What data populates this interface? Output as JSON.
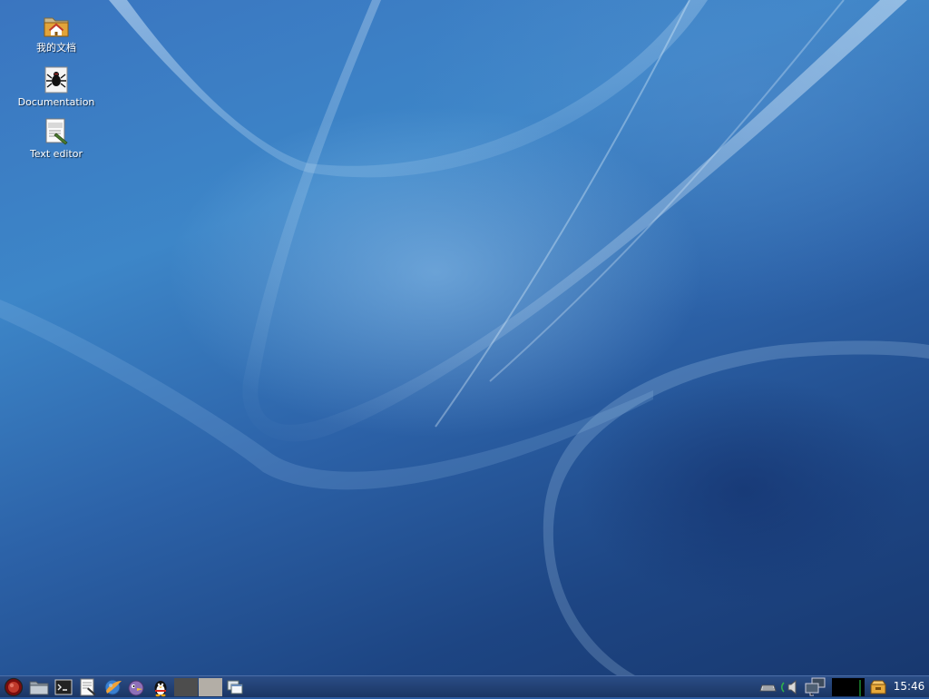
{
  "desktop": {
    "icons": [
      {
        "label": "我的文档",
        "icon": "home-folder-icon"
      },
      {
        "label": "Documentation",
        "icon": "spider-docs-icon"
      },
      {
        "label": "Text editor",
        "icon": "text-editor-icon"
      }
    ]
  },
  "taskbar": {
    "launchers": [
      {
        "icon": "start-menu-icon"
      },
      {
        "icon": "file-manager-icon"
      },
      {
        "icon": "terminal-icon"
      },
      {
        "icon": "text-editor-launcher-icon"
      },
      {
        "icon": "web-browser-icon"
      },
      {
        "icon": "pidgin-chat-icon"
      },
      {
        "icon": "qq-penguin-icon"
      }
    ],
    "workspaces": [
      {
        "name": "desktop-1",
        "active": true
      },
      {
        "name": "desktop-2",
        "active": false
      }
    ],
    "tray": [
      {
        "icon": "keyboard-icon"
      },
      {
        "icon": "volume-icon"
      },
      {
        "icon": "network-icon"
      },
      {
        "icon": "cpu-monitor-icon"
      },
      {
        "icon": "update-notifier-icon"
      }
    ],
    "clock": "15:46"
  },
  "colors": {
    "panel": "#1f3d70",
    "desktop_accent": "#3d86c8"
  }
}
